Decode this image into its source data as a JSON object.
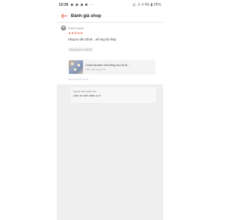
{
  "status_bar": {
    "time": "12:26",
    "notifications": "◉ ◉ ◉ ◙ ···",
    "right": "◎ .ıl .ıl 4G ▮ 26%"
  },
  "header": {
    "title": "Đánh giá shop"
  },
  "review": {
    "username": "thanh truyen",
    "stars": "★★★★★",
    "comment": "Shop tư vấn rất ok ...sẽ ủng hộ shop",
    "variant": "Shop phục vụ rất tốt"
  },
  "product": {
    "name": "Chuột hamster nhai tiếng cho trẻ tậ...",
    "variant": "Phân loại hàng: Hồ"
  },
  "date": "05-01-2019 20:50",
  "seller_reply": {
    "label": "Người bán phản hồi:",
    "text": "Cảm ơn anh nhiều ạ !!!"
  },
  "colors": {
    "accent": "#e8553e",
    "lower_background": "#efefef"
  }
}
